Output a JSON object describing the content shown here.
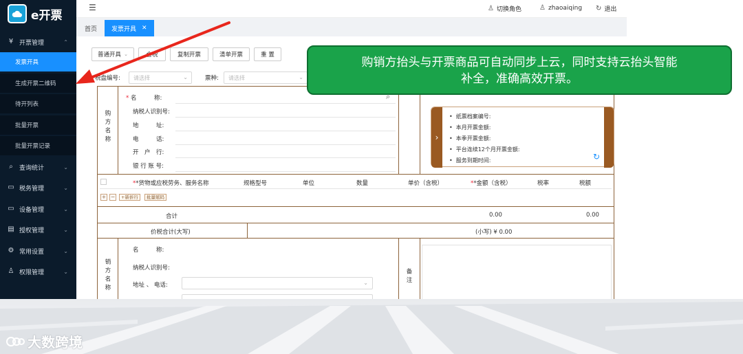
{
  "app": {
    "logo_text": "e开票",
    "logo_icon": "cloud-icon"
  },
  "sidebar": {
    "groups": [
      {
        "label": "开票管理",
        "icon": "yen-icon",
        "expanded": true
      },
      {
        "label": "查询统计",
        "icon": "search-icon"
      },
      {
        "label": "税务管理",
        "icon": "building-icon"
      },
      {
        "label": "设备管理",
        "icon": "laptop-icon"
      },
      {
        "label": "授权管理",
        "icon": "panel-icon"
      },
      {
        "label": "常用设置",
        "icon": "gear-icon"
      },
      {
        "label": "权限管理",
        "icon": "user-icon"
      }
    ],
    "items": [
      {
        "label": "发票开具",
        "active": true
      },
      {
        "label": "生成开票二维码"
      },
      {
        "label": "待开列表"
      },
      {
        "label": "批量开票"
      },
      {
        "label": "批量开票记录"
      }
    ]
  },
  "topbar": {
    "switch_role": "切换角色",
    "username": "zhaoaiqing",
    "logout": "退出"
  },
  "tabs": [
    {
      "label": "首页"
    },
    {
      "label": "发票开具",
      "active": true
    }
  ],
  "toolbar": {
    "invoice_type": "普通开具",
    "btn2": "合税",
    "btn3": "复制开票",
    "btn4": "清单开票",
    "btn5": "重 置"
  },
  "filters": {
    "tax_code_label": "税盘编号:",
    "tax_code_placeholder": "请选择",
    "ticket_type_label": "票种:",
    "ticket_type_placeholder": "请选择"
  },
  "buyer": {
    "section_label": "购方名称",
    "fields": [
      "名　　　称:",
      "纳税人识别号:",
      "地　　　址:",
      "电　　　话:",
      "开　户　行:",
      "银 行 账 号:"
    ]
  },
  "info_card": {
    "lines": [
      "纸票档案编号:",
      "本月开票金额:",
      "本季开票金额:",
      "平台连续12个月开票金额:",
      "服务到期时间:"
    ]
  },
  "goods_table": {
    "headers": [
      "*货物或应税劳务、服务名称",
      "规格型号",
      "单位",
      "数量",
      "单价（含税）",
      "*金额（含税）",
      "税率",
      "税额"
    ],
    "add_discount": "+新折行",
    "batch_code": "批量赋码"
  },
  "totals": {
    "label": "合计",
    "amount": "0.00",
    "tax": "0.00",
    "in_words_label": "价税合计(大写)",
    "lowercase": "(小写) ¥ 0.00"
  },
  "seller": {
    "section_label": "销方名称",
    "fields": [
      "名　　　称:",
      "纳税人识别号:",
      "地址 、 电话:"
    ],
    "remarks_label": "备注"
  },
  "callout": {
    "line1": "购销方抬头与开票商品可自动同步上云，同时支持云抬头智能",
    "line2": "补全，准确高效开票。"
  },
  "colors": {
    "sidebar_bg": "#0b1b2b",
    "accent": "#1890ff",
    "callout_bg": "#1aa34a",
    "arrow": "#e8261c",
    "invoice_border": "#8c6239"
  },
  "watermark": {
    "text": "大数跨境"
  }
}
